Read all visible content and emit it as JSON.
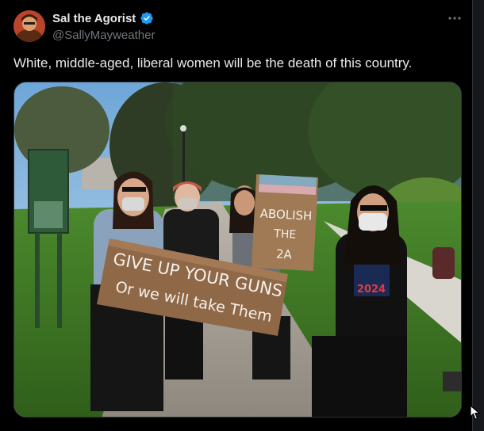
{
  "post": {
    "author": {
      "display_name": "Sal the Agorist",
      "handle": "@SallyMayweather",
      "verified": true,
      "verified_color": "#1d9bf0"
    },
    "text": "White, middle-aged, liberal women will be the death of this country.",
    "menu_icon": "more-horizontal-icon",
    "media": {
      "type": "photo",
      "signs": {
        "large_sign_line1": "GIVE UP YOUR GUNS",
        "large_sign_line2": "Or we will take Them",
        "small_sign_line1": "ABOLISH",
        "small_sign_line2": "THE",
        "small_sign_line3": "2A",
        "shirt_text": "2024"
      }
    }
  },
  "colors": {
    "background": "#000000",
    "text_primary": "#e7e9ea",
    "text_secondary": "#71767b",
    "border": "#2f3336"
  }
}
